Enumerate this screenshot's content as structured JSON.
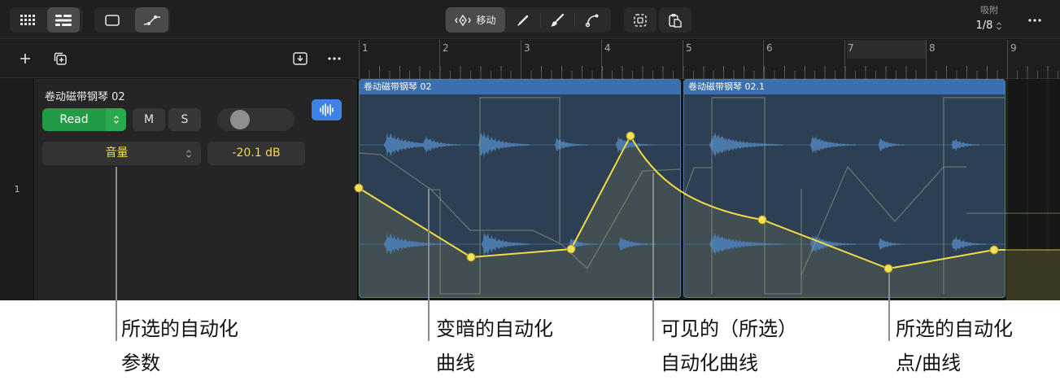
{
  "toolbar": {
    "view_buttons": [
      {
        "icon": "grid-view-icon",
        "selected": false
      },
      {
        "icon": "tracks-view-icon",
        "selected": true
      }
    ],
    "mode_buttons": [
      {
        "icon": "region-view-icon",
        "selected": false
      },
      {
        "icon": "automation-icon",
        "selected": true
      }
    ],
    "tools": [
      {
        "icon": "move-tool-icon",
        "label": "移动",
        "selected": true
      },
      {
        "icon": "pencil-tool-icon",
        "selected": false
      },
      {
        "icon": "brush-tool-icon",
        "selected": false
      },
      {
        "icon": "curve-tool-icon",
        "selected": false
      }
    ],
    "marquee_icon": "marquee-select-icon",
    "paste_icon": "paste-icon",
    "snap": {
      "label": "吸附",
      "value": "1/8",
      "icon": "chevron-up-down-icon"
    },
    "more_icon": "more-icon"
  },
  "track_list_header": {
    "add_icon": "plus-icon",
    "duplicate_icon": "duplicate-track-icon",
    "import_icon": "import-tray-icon",
    "more_icon": "more-icon"
  },
  "ruler": {
    "bars": [
      "1",
      "2",
      "3",
      "4",
      "5",
      "6",
      "7",
      "8",
      "9"
    ]
  },
  "track": {
    "number": "1",
    "name": "卷动磁带钢琴 02",
    "automation_mode": "Read",
    "mute_label": "M",
    "solo_label": "S",
    "automation_parameter": "音量",
    "parameter_value": "-20.1 dB",
    "automation_button_icon": "waveform-icon"
  },
  "regions": [
    {
      "name": "卷动磁带钢琴 02"
    },
    {
      "name": "卷动磁带钢琴 02.1"
    }
  ],
  "callouts": [
    {
      "lines": [
        "所选的自动化",
        "参数"
      ]
    },
    {
      "lines": [
        "变暗的自动化",
        "曲线"
      ]
    },
    {
      "lines": [
        "可见的（所选）",
        "自动化曲线"
      ]
    },
    {
      "lines": [
        "所选的自动化",
        "点/曲线"
      ]
    }
  ],
  "colors": {
    "read_mode": "#239a45",
    "automation_selected": "#f2d94a",
    "automation_dimmed": "#8fa186",
    "region_header": "#3a6fb0",
    "region_body": "#2d4053",
    "waveform": "#4b79ab",
    "accent_blue": "#3d83e6"
  }
}
